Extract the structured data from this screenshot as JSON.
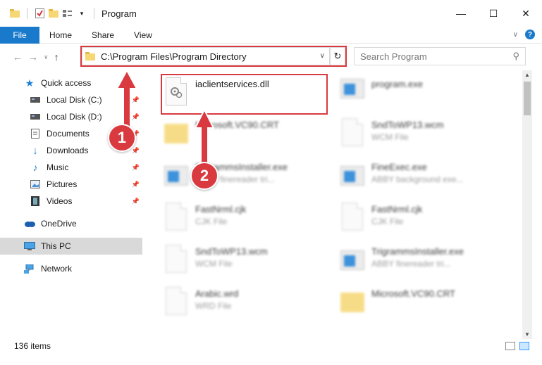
{
  "window": {
    "title": "Program",
    "controls": {
      "minimize": "—",
      "maximize": "☐",
      "close": "✕"
    }
  },
  "ribbon": {
    "tabs": [
      "File",
      "Home",
      "Share",
      "View"
    ],
    "help": "?"
  },
  "nav": {
    "address": "C:\\Program Files\\Program Directory",
    "search_placeholder": "Search Program"
  },
  "sidebar": {
    "items": [
      {
        "label": "Quick access",
        "icon": "star-icon"
      },
      {
        "label": "Local Disk (C:)",
        "icon": "drive-icon",
        "pinned": true
      },
      {
        "label": "Local Disk (D:)",
        "icon": "drive-icon",
        "pinned": true
      },
      {
        "label": "Documents",
        "icon": "documents-icon",
        "pinned": true
      },
      {
        "label": "Downloads",
        "icon": "downloads-icon",
        "pinned": true
      },
      {
        "label": "Music",
        "icon": "music-icon",
        "pinned": true
      },
      {
        "label": "Pictures",
        "icon": "pictures-icon",
        "pinned": true
      },
      {
        "label": "Videos",
        "icon": "videos-icon",
        "pinned": true
      },
      {
        "label": "OneDrive",
        "icon": "cloud-icon"
      },
      {
        "label": "This PC",
        "icon": "computer-icon",
        "selected": true
      },
      {
        "label": "Network",
        "icon": "network-icon"
      }
    ]
  },
  "files": [
    {
      "name": "iaclientservices.dll",
      "type": "",
      "icon": "dll-file-icon"
    },
    {
      "name": "program.exe",
      "type": "",
      "icon": "exe-file-icon"
    },
    {
      "name": "Microsoft.VC90.CRT",
      "type": "",
      "icon": "folder-icon"
    },
    {
      "name": "SndToWP13.wcm",
      "type": "WCM File",
      "icon": "file-icon"
    },
    {
      "name": "TrigrammsInstaller.exe",
      "type": "ABBY finereader tri...",
      "icon": "exe-file-icon"
    },
    {
      "name": "FineExec.exe",
      "type": "ABBY background exe...",
      "icon": "exe-file-icon"
    },
    {
      "name": "FastNrml.cjk",
      "type": "CJK File",
      "icon": "file-icon"
    },
    {
      "name": "FastNrml.cjk",
      "type": "CJK File",
      "icon": "file-icon"
    },
    {
      "name": "SndToWP13.wcm",
      "type": "WCM File",
      "icon": "file-icon"
    },
    {
      "name": "TrigrammsInstaller.exe",
      "type": "ABBY finereader tri...",
      "icon": "exe-file-icon"
    },
    {
      "name": "Arabic.wrd",
      "type": "WRD File",
      "icon": "file-icon"
    },
    {
      "name": "Microsoft.VC90.CRT",
      "type": "",
      "icon": "folder-icon"
    }
  ],
  "status": {
    "count": "136 items"
  },
  "annotations": {
    "step1": "1",
    "step2": "2"
  },
  "colors": {
    "accent": "#1979ca",
    "highlight": "#d93a3f",
    "selected": "#d9d9d9"
  }
}
